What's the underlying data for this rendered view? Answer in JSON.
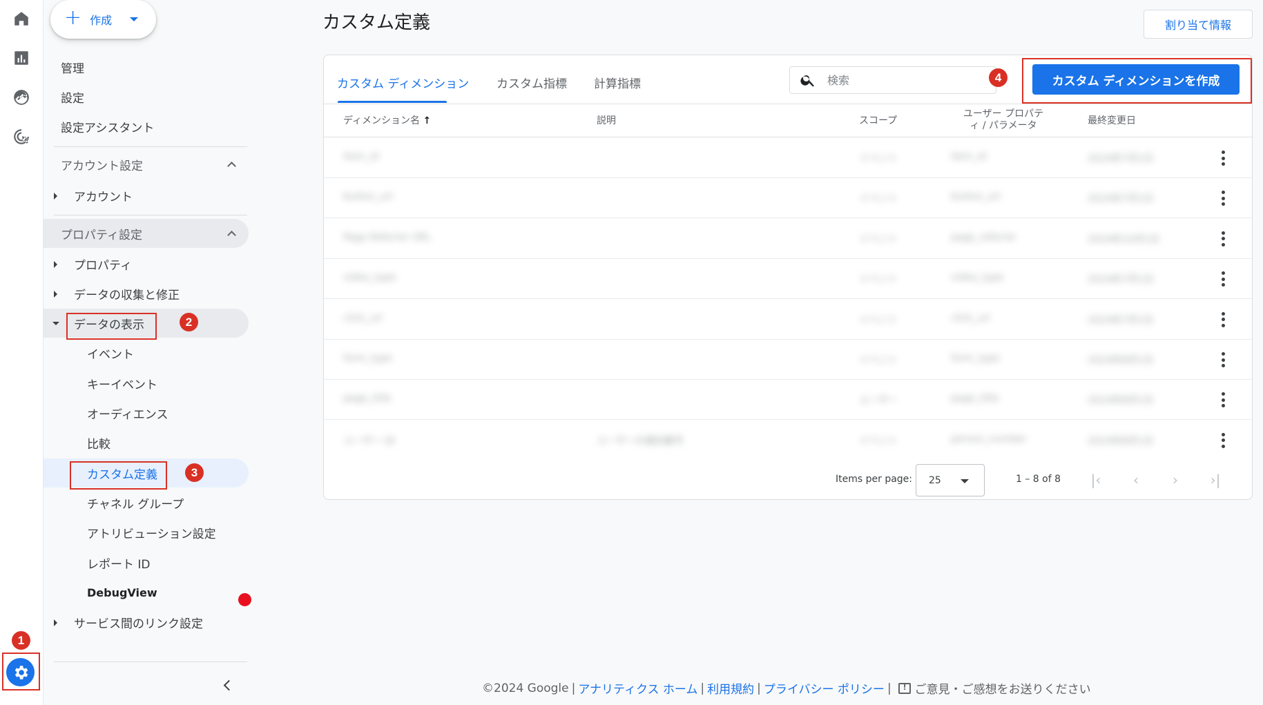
{
  "page": {
    "title": "カスタム定義",
    "assign_button": "割り当て情報"
  },
  "create": {
    "label": "作成"
  },
  "rail": [
    "home-icon",
    "reports-icon",
    "explore-icon",
    "advertising-icon",
    "admin-gear-icon"
  ],
  "nav": {
    "admin": "管理",
    "settings": "設定",
    "setup_assistant": "設定アシスタント",
    "account_settings": "アカウント設定",
    "account": "アカウント",
    "property_settings": "プロパティ設定",
    "property": "プロパティ",
    "data_collection": "データの収集と修正",
    "data_display": "データの表示",
    "events": "イベント",
    "key_events": "キーイベント",
    "audiences": "オーディエンス",
    "comparisons": "比較",
    "custom_definitions": "カスタム定義",
    "channel_groups": "チャネル グループ",
    "attribution": "アトリビューション設定",
    "report_id": "レポート ID",
    "debugview": "DebugView",
    "product_links": "サービス間のリンク設定"
  },
  "annotations": {
    "step1": "1",
    "step2": "2",
    "step3": "3",
    "step4": "4"
  },
  "tabs": [
    "カスタム ディメンション",
    "カスタム指標",
    "計算指標"
  ],
  "search": {
    "placeholder": "検索"
  },
  "create_dimension_button": "カスタム ディメンションを作成",
  "table": {
    "headers": {
      "name": "ディメンション名",
      "sort_arrow": "↑",
      "description": "説明",
      "scope": "スコープ",
      "user_property_line1": "ユーザー プロパテ",
      "user_property_line2": "ィ / パラメータ",
      "last_changed": "最終変更日"
    },
    "rows": [
      {
        "name": "item_id",
        "description": "",
        "scope": "イベント",
        "param": "item_id",
        "date": "2024年7月1日"
      },
      {
        "name": "button_url",
        "description": "",
        "scope": "イベント",
        "param": "button_url",
        "date": "2024年7月1日"
      },
      {
        "name": "Page Referrer URL",
        "description": "",
        "scope": "イベント",
        "param": "page_referrer",
        "date": "2024年10月1日"
      },
      {
        "name": "video_type",
        "description": "",
        "scope": "イベント",
        "param": "video_type",
        "date": "2024年7月1日"
      },
      {
        "name": "click_url",
        "description": "",
        "scope": "イベント",
        "param": "click_url",
        "date": "2024年7月1日"
      },
      {
        "name": "form_type",
        "description": "",
        "scope": "イベント",
        "param": "form_type",
        "date": "2024年8月1日"
      },
      {
        "name": "page_title",
        "description": "",
        "scope": "ユーザー",
        "param": "page_title",
        "date": "2024年8月1日"
      },
      {
        "name": "ユーザー ID",
        "description": "ユーザーの識別番号",
        "scope": "イベント",
        "param": "person_number",
        "date": "2024年8月1日"
      }
    ]
  },
  "pagination": {
    "items_per_page_label": "Items per page:",
    "items_per_page": "25",
    "range": "1 – 8 of 8"
  },
  "footer": {
    "copyright": "©2024 Google",
    "home": "アナリティクス ホーム",
    "terms": "利用規約",
    "privacy": "プライバシー ポリシー",
    "feedback": "ご意見・ご感想をお送りください"
  },
  "colors": {
    "accent": "#1a73e8",
    "annotation": "#d93025"
  }
}
